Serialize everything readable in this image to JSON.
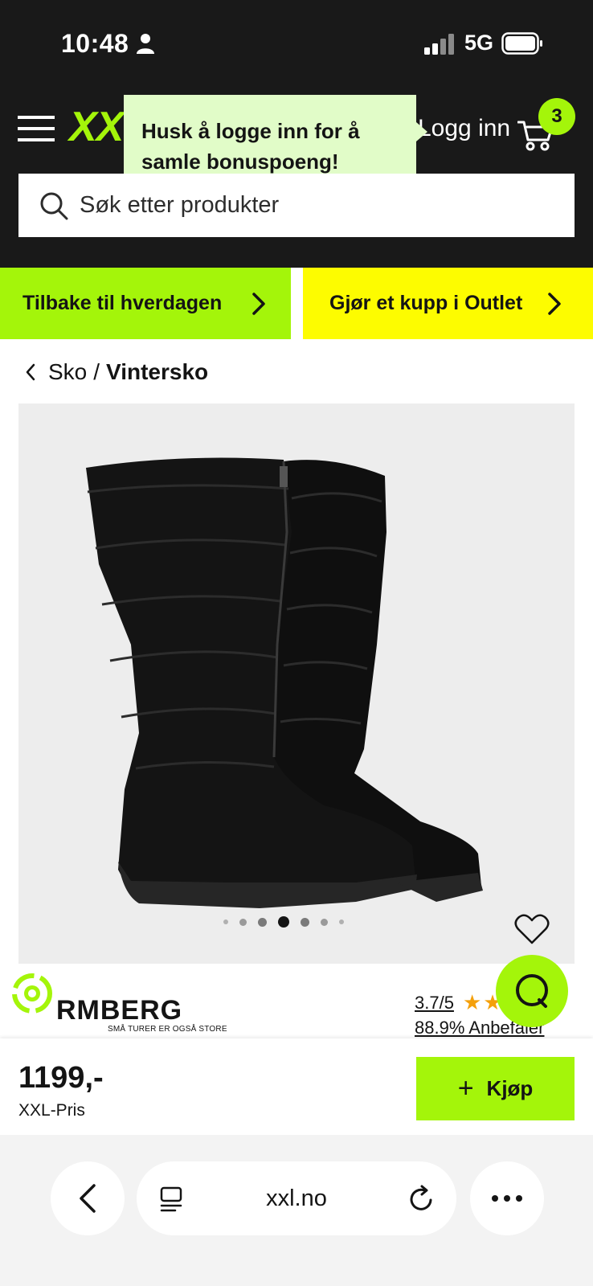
{
  "status_bar": {
    "time": "10:48",
    "network": "5G"
  },
  "header": {
    "logo": "XXL",
    "login_label": "Logg inn",
    "cart_count": "3",
    "tooltip": "Husk å logge inn for å samle bonuspoeng!",
    "search_placeholder": "Søk etter produkter"
  },
  "promos": {
    "left": "Tilbake til hverdagen",
    "right": "Gjør et kupp i Outlet"
  },
  "breadcrumb": {
    "parent": "Sko",
    "separator": "/",
    "current": "Vintersko"
  },
  "product": {
    "carousel_total": 7,
    "carousel_active_index": 3,
    "brand": "RMBERG",
    "brand_tagline": "SMÅ TURER ER OGSÅ STORE",
    "rating": "3.7/5",
    "stars": 3.7,
    "recommend": "88.9% Anbefaler",
    "price": "1199,-",
    "price_label": "XXL-Pris",
    "buy_label": "Kjøp"
  },
  "browser": {
    "url": "xxl.no"
  },
  "colors": {
    "accent_green": "#a4f50a",
    "accent_yellow": "#fdfc00",
    "header_bg": "#191919",
    "tooltip_bg": "#e1fcc8"
  }
}
